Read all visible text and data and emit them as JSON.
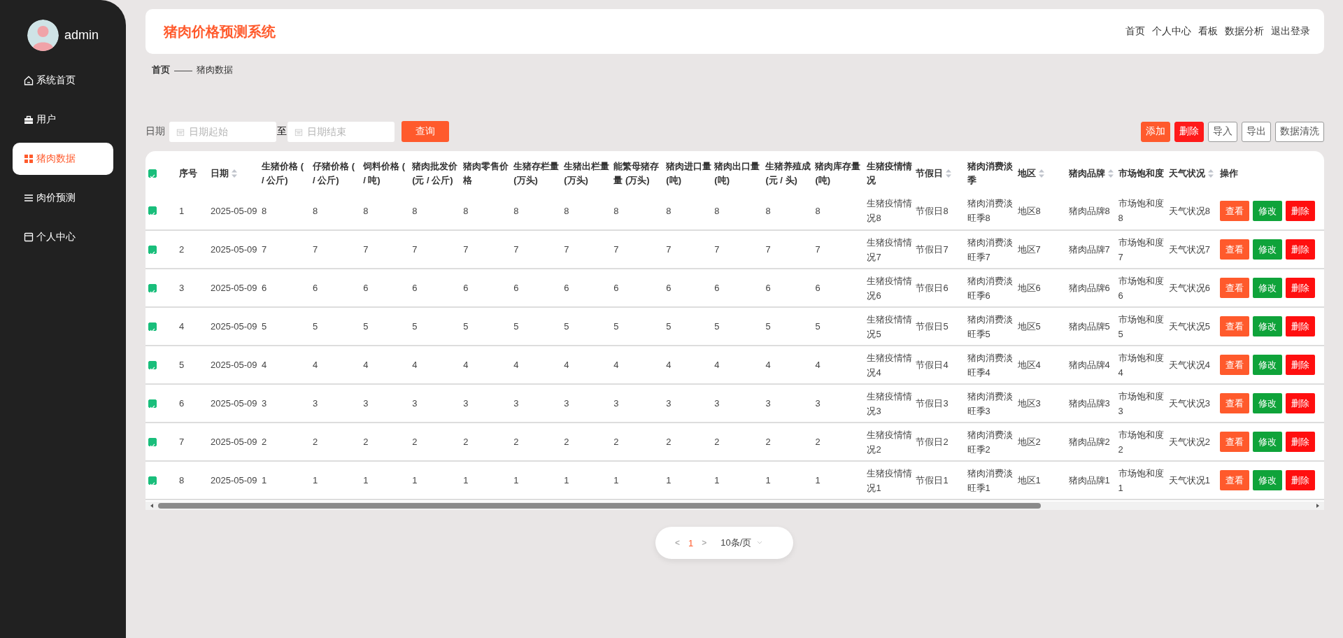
{
  "sidebar": {
    "user": {
      "name": "admin"
    },
    "items": [
      {
        "label": "系统首页",
        "selected": false
      },
      {
        "label": "用户",
        "selected": false
      },
      {
        "label": "猪肉数据",
        "selected": true
      },
      {
        "label": "肉价预测",
        "selected": false
      },
      {
        "label": "个人中心",
        "selected": false
      }
    ]
  },
  "header": {
    "title": "猪肉价格预测系统",
    "nav": [
      "首页",
      "个人中心",
      "看板",
      "数据分析",
      "退出登录"
    ]
  },
  "breadcrumb": {
    "home": "首页",
    "separator": "——",
    "current": "猪肉数据"
  },
  "filter": {
    "label": "日期",
    "start_placeholder": "日期起始",
    "to": "至",
    "end_placeholder": "日期结束",
    "button": "查询"
  },
  "actions": [
    {
      "label": "添加",
      "kind": "primary"
    },
    {
      "label": "删除",
      "kind": "danger"
    },
    {
      "label": "导入",
      "kind": "plain"
    },
    {
      "label": "导出",
      "kind": "plain"
    },
    {
      "label": "数据清洗",
      "kind": "plain"
    }
  ],
  "table": {
    "all_checked": true,
    "columns": [
      {
        "label": "序号",
        "sortable": false
      },
      {
        "label": "日期",
        "sortable": true
      },
      {
        "label": "生猪价格 (\n/ 公斤)",
        "sortable": false
      },
      {
        "label": "仔猪价格 (\n/ 公斤)",
        "sortable": false
      },
      {
        "label": "饲料价格 (\n/ 吨)",
        "sortable": false
      },
      {
        "label": "猪肉批发价\n(元 / 公斤)",
        "sortable": false
      },
      {
        "label": "猪肉零售价格",
        "sortable": false
      },
      {
        "label": "生猪存栏量\n(万头)",
        "sortable": false
      },
      {
        "label": "生猪出栏量\n(万头)",
        "sortable": false
      },
      {
        "label": "能繁母猪存量 (万头)",
        "sortable": false
      },
      {
        "label": "猪肉进口量\n(吨)",
        "sortable": false
      },
      {
        "label": "猪肉出口量\n(吨)",
        "sortable": false
      },
      {
        "label": "生猪养殖成\n(元 / 头)",
        "sortable": false
      },
      {
        "label": "猪肉库存量\n(吨)",
        "sortable": false
      },
      {
        "label": "生猪疫情情况",
        "sortable": false
      },
      {
        "label": "节假日",
        "sortable": true
      },
      {
        "label": "猪肉消费淡季",
        "sortable": false
      },
      {
        "label": "地区",
        "sortable": true
      },
      {
        "label": "猪肉品牌",
        "sortable": true
      },
      {
        "label": "市场饱和度",
        "sortable": false
      },
      {
        "label": "天气状况",
        "sortable": true
      },
      {
        "label": "操作",
        "sortable": false
      }
    ],
    "rows": [
      {
        "checked": true,
        "cells": [
          "1",
          "2025-05-09",
          "8",
          "8",
          "8",
          "8",
          "8",
          "8",
          "8",
          "8",
          "8",
          "8",
          "8",
          "8",
          "生猪疫情情况8",
          "节假日8",
          "猪肉消费淡旺季8",
          "地区8",
          "猪肉品牌8",
          "市场饱和度8",
          "天气状况8"
        ],
        "actions": [
          "查看",
          "修改",
          "删除"
        ]
      },
      {
        "checked": true,
        "cells": [
          "2",
          "2025-05-09",
          "7",
          "7",
          "7",
          "7",
          "7",
          "7",
          "7",
          "7",
          "7",
          "7",
          "7",
          "7",
          "生猪疫情情况7",
          "节假日7",
          "猪肉消费淡旺季7",
          "地区7",
          "猪肉品牌7",
          "市场饱和度7",
          "天气状况7"
        ],
        "actions": [
          "查看",
          "修改",
          "删除"
        ]
      },
      {
        "checked": true,
        "cells": [
          "3",
          "2025-05-09",
          "6",
          "6",
          "6",
          "6",
          "6",
          "6",
          "6",
          "6",
          "6",
          "6",
          "6",
          "6",
          "生猪疫情情况6",
          "节假日6",
          "猪肉消费淡旺季6",
          "地区6",
          "猪肉品牌6",
          "市场饱和度6",
          "天气状况6"
        ],
        "actions": [
          "查看",
          "修改",
          "删除"
        ]
      },
      {
        "checked": true,
        "cells": [
          "4",
          "2025-05-09",
          "5",
          "5",
          "5",
          "5",
          "5",
          "5",
          "5",
          "5",
          "5",
          "5",
          "5",
          "5",
          "生猪疫情情况5",
          "节假日5",
          "猪肉消费淡旺季5",
          "地区5",
          "猪肉品牌5",
          "市场饱和度5",
          "天气状况5"
        ],
        "actions": [
          "查看",
          "修改",
          "删除"
        ]
      },
      {
        "checked": true,
        "cells": [
          "5",
          "2025-05-09",
          "4",
          "4",
          "4",
          "4",
          "4",
          "4",
          "4",
          "4",
          "4",
          "4",
          "4",
          "4",
          "生猪疫情情况4",
          "节假日4",
          "猪肉消费淡旺季4",
          "地区4",
          "猪肉品牌4",
          "市场饱和度4",
          "天气状况4"
        ],
        "actions": [
          "查看",
          "修改",
          "删除"
        ]
      },
      {
        "checked": true,
        "cells": [
          "6",
          "2025-05-09",
          "3",
          "3",
          "3",
          "3",
          "3",
          "3",
          "3",
          "3",
          "3",
          "3",
          "3",
          "3",
          "生猪疫情情况3",
          "节假日3",
          "猪肉消费淡旺季3",
          "地区3",
          "猪肉品牌3",
          "市场饱和度3",
          "天气状况3"
        ],
        "actions": [
          "查看",
          "修改",
          "删除"
        ]
      },
      {
        "checked": true,
        "cells": [
          "7",
          "2025-05-09",
          "2",
          "2",
          "2",
          "2",
          "2",
          "2",
          "2",
          "2",
          "2",
          "2",
          "2",
          "2",
          "生猪疫情情况2",
          "节假日2",
          "猪肉消费淡旺季2",
          "地区2",
          "猪肉品牌2",
          "市场饱和度2",
          "天气状况2"
        ],
        "actions": [
          "查看",
          "修改",
          "删除"
        ]
      },
      {
        "checked": true,
        "cells": [
          "8",
          "2025-05-09",
          "1",
          "1",
          "1",
          "1",
          "1",
          "1",
          "1",
          "1",
          "1",
          "1",
          "1",
          "1",
          "生猪疫情情况1",
          "节假日1",
          "猪肉消费淡旺季1",
          "地区1",
          "猪肉品牌1",
          "市场饱和度1",
          "天气状况1"
        ],
        "actions": [
          "查看",
          "修改",
          "删除"
        ]
      }
    ]
  },
  "pagination": {
    "prev": "<",
    "pages": [
      {
        "label": "1",
        "selected": true
      }
    ],
    "next": ">",
    "page_size": "10条/页"
  }
}
